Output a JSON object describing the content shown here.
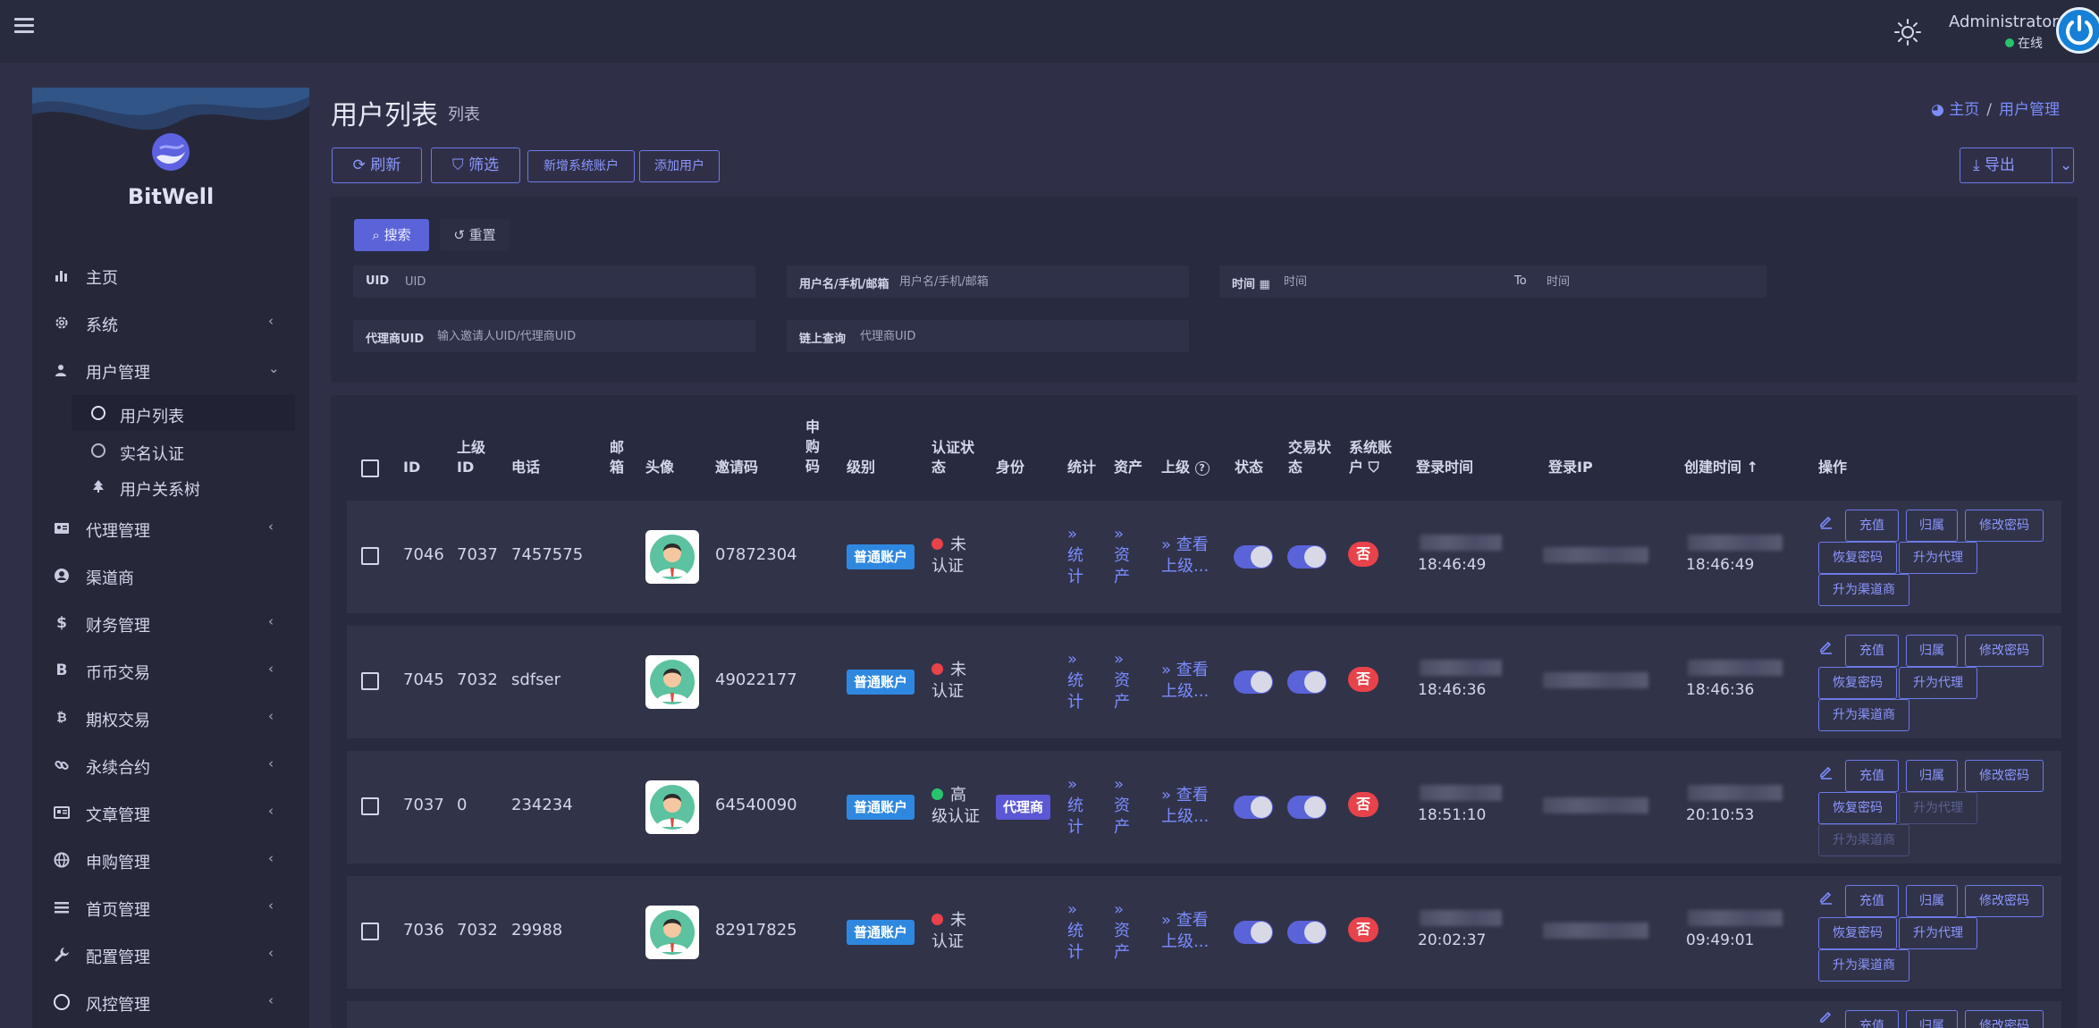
{
  "header": {
    "admin_name": "Administrator",
    "status": "在线"
  },
  "sidebar": {
    "brand": "BitWell",
    "items": [
      {
        "label": "主页",
        "icon": "bar-chart-icon"
      },
      {
        "label": "系统",
        "icon": "gear-icon"
      },
      {
        "label": "用户管理",
        "icon": "users-icon"
      },
      {
        "label": "代理管理",
        "icon": "id-card-icon"
      },
      {
        "label": "渠道商",
        "icon": "user-circle-icon"
      },
      {
        "label": "财务管理",
        "icon": "dollar-icon"
      },
      {
        "label": "币币交易",
        "icon": "bitcoin-b-icon"
      },
      {
        "label": "期权交易",
        "icon": "bitcoin-icon"
      },
      {
        "label": "永续合约",
        "icon": "link-icon"
      },
      {
        "label": "文章管理",
        "icon": "newspaper-icon"
      },
      {
        "label": "申购管理",
        "icon": "globe-icon"
      },
      {
        "label": "首页管理",
        "icon": "list-icon"
      },
      {
        "label": "配置管理",
        "icon": "wrench-icon"
      },
      {
        "label": "风控管理",
        "icon": "circle-icon"
      }
    ],
    "sub_items": [
      {
        "label": "用户列表"
      },
      {
        "label": "实名认证"
      },
      {
        "label": "用户关系树"
      }
    ]
  },
  "page": {
    "title": "用户列表",
    "subtitle": "列表",
    "breadcrumb_home": "主页",
    "breadcrumb_current": "用户管理"
  },
  "toolbar": {
    "refresh": "刷新",
    "filter": "筛选",
    "add_system_account": "新增系统账户",
    "add_user": "添加用户",
    "export": "导出"
  },
  "search": {
    "search_btn": "搜索",
    "reset_btn": "重置",
    "uid_label": "UID",
    "uid_placeholder": "UID",
    "username_label": "用户名/手机/邮箱",
    "username_placeholder": "用户名/手机/邮箱",
    "time_label": "时间",
    "time_placeholder": "时间",
    "to_label": "To",
    "time_end_placeholder": "时间",
    "agent_uid_label": "代理商UID",
    "agent_uid_placeholder": "输入邀请人UID/代理商UID",
    "chain_label": "链上查询",
    "chain_placeholder": "代理商UID"
  },
  "table": {
    "headers": {
      "id": "ID",
      "parent_id_1": "上级",
      "parent_id_2": "ID",
      "phone": "电话",
      "email_1": "邮",
      "email_2": "箱",
      "avatar": "头像",
      "invite_code": "邀请码",
      "sub_code_1": "申",
      "sub_code_2": "购",
      "sub_code_3": "码",
      "level": "级别",
      "auth_1": "认证状",
      "auth_2": "态",
      "identity": "身份",
      "stats": "统计",
      "assets": "资产",
      "parent": "上级",
      "status": "状态",
      "trade_1": "交易状",
      "trade_2": "态",
      "sys_1": "系统账",
      "sys_2": "户",
      "login_time": "登录时间",
      "login_ip": "登录IP",
      "created_time": "创建时间",
      "actions": "操作"
    },
    "rows": [
      {
        "id": "7046",
        "parent_id": "7037",
        "phone": "7457575",
        "invite": "07872304",
        "level": "普通账户",
        "auth_1": "未",
        "auth_2": "认证",
        "auth_color": "#e8424a",
        "identity": "",
        "login_time": "18:46:49",
        "created_time": "18:46:49",
        "sys": "否"
      },
      {
        "id": "7045",
        "parent_id": "7032",
        "phone": "sdfser",
        "invite": "49022177",
        "level": "普通账户",
        "auth_1": "未",
        "auth_2": "认证",
        "auth_color": "#e8424a",
        "identity": "",
        "login_time": "18:46:36",
        "created_time": "18:46:36",
        "sys": "否"
      },
      {
        "id": "7037",
        "parent_id": "0",
        "phone": "234234",
        "invite": "64540090",
        "level": "普通账户",
        "auth_1": "高",
        "auth_2": "级认证",
        "auth_color": "#27c46d",
        "identity": "代理商",
        "login_time": "18:51:10",
        "created_time": "20:10:53",
        "sys": "否"
      },
      {
        "id": "7036",
        "parent_id": "7032",
        "phone": "29988",
        "invite": "82917825",
        "level": "普通账户",
        "auth_1": "未",
        "auth_2": "认证",
        "auth_color": "#e8424a",
        "identity": "",
        "login_time": "20:02:37",
        "created_time": "09:49:01",
        "sys": "否"
      }
    ],
    "link_stats_1": "»",
    "link_stats_2": "统",
    "link_stats_3": "计",
    "link_assets_1": "»",
    "link_assets_2": "资",
    "link_assets_3": "产",
    "link_parent_1": "» 查看",
    "link_parent_2": "上级...",
    "actions": {
      "recharge": "充值",
      "belong": "归属",
      "change_pwd": "修改密码",
      "reset_pwd": "恢复密码",
      "to_agent": "升为代理",
      "to_channel": "升为渠道商"
    }
  }
}
